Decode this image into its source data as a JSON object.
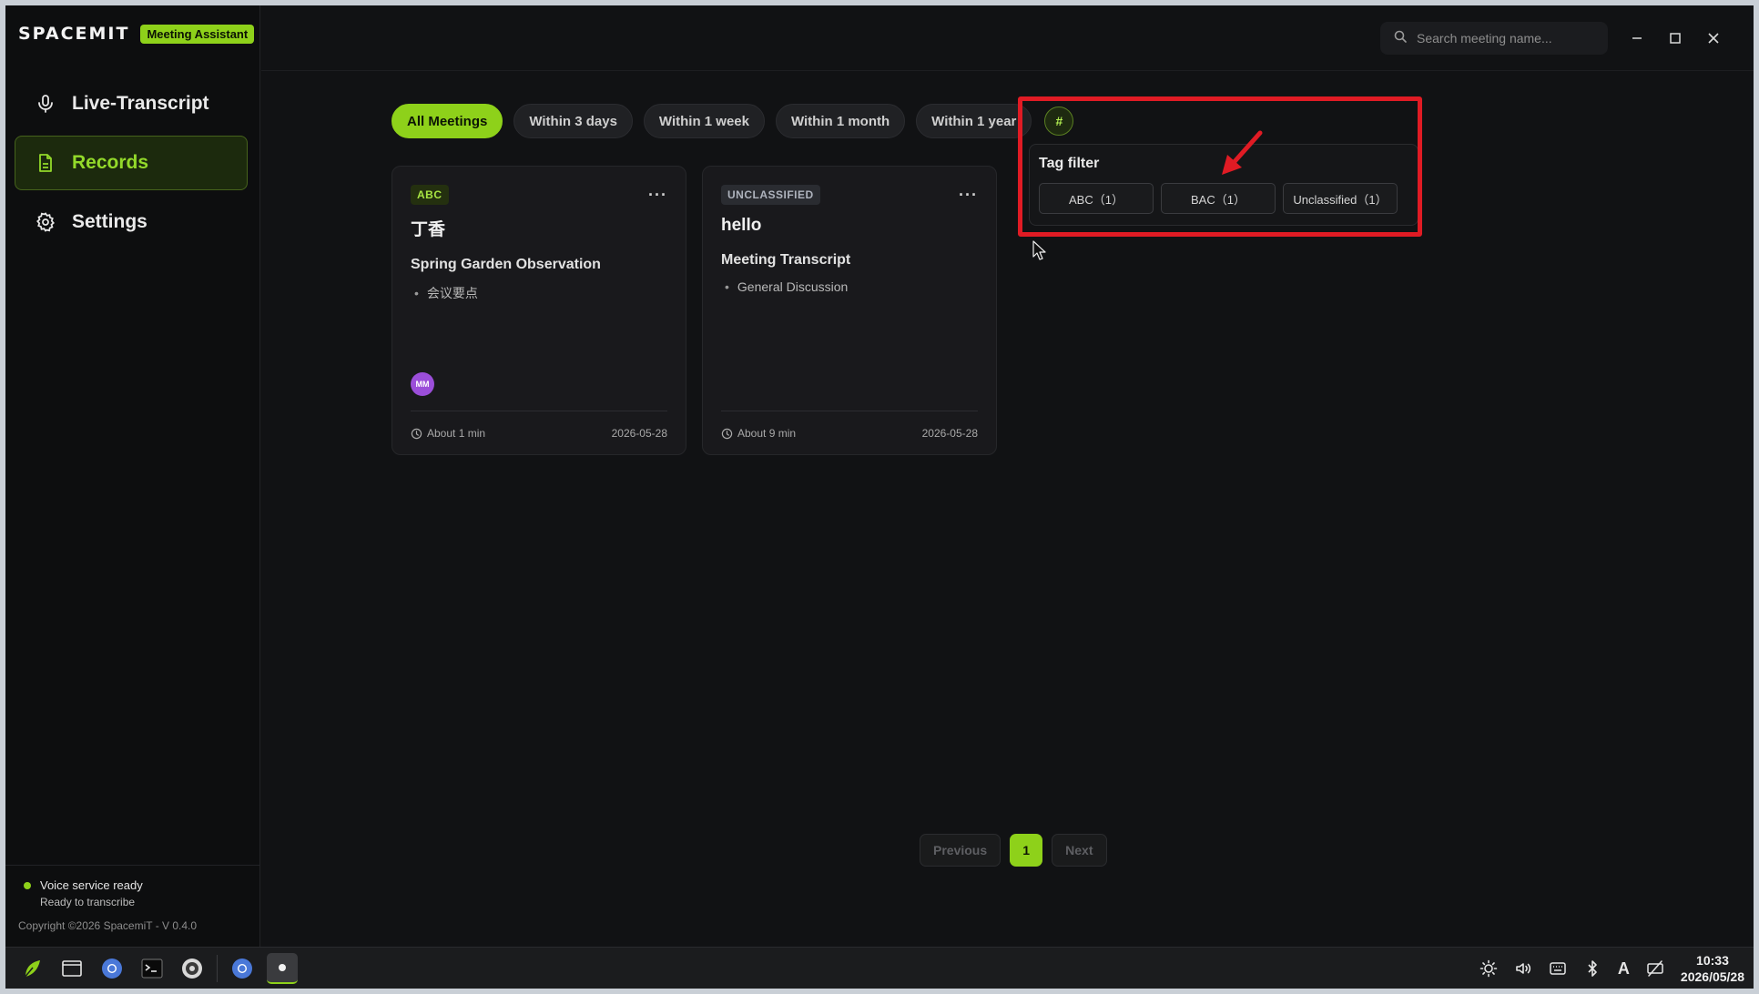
{
  "app": {
    "logo": "SPACEMIT",
    "badge": "Meeting Assistant"
  },
  "nav": {
    "items": [
      {
        "label": "Live-Transcript",
        "icon": "microphone-icon"
      },
      {
        "label": "Records",
        "icon": "document-icon",
        "active": true
      },
      {
        "label": "Settings",
        "icon": "gear-icon"
      }
    ]
  },
  "status": {
    "title": "Voice service ready",
    "subtitle": "Ready to transcribe",
    "copyright": "Copyright ©2026 SpacemiT - V 0.4.0"
  },
  "search": {
    "placeholder": "Search meeting name..."
  },
  "filters": {
    "chips": [
      "All Meetings",
      "Within 3 days",
      "Within 1 week",
      "Within 1 month",
      "Within 1 year"
    ],
    "active": "All Meetings",
    "tag_button": "#"
  },
  "tag_filter": {
    "title": "Tag filter",
    "tags": [
      "ABC（1）",
      "BAC（1）",
      "Unclassified（1）"
    ]
  },
  "cards": [
    {
      "tag": "ABC",
      "title": "丁香",
      "subtitle": "Spring Garden Observation",
      "bullet": "会议要点",
      "avatar": "MM",
      "duration": "About 1 min",
      "date": "2026-05-28",
      "more": "···"
    },
    {
      "tag": "UNCLASSIFIED",
      "title": "hello",
      "subtitle": "Meeting Transcript",
      "bullet": "General Discussion",
      "duration": "About 9 min",
      "date": "2026-05-28",
      "more": "···"
    }
  ],
  "pagination": {
    "previous": "Previous",
    "current": "1",
    "next": "Next"
  },
  "taskbar": {
    "time": "10:33",
    "date": "2026/05/28",
    "input_method": "A"
  },
  "colors": {
    "accent": "#8ed11a",
    "background": "#111214",
    "annotation": "#e01b24"
  }
}
